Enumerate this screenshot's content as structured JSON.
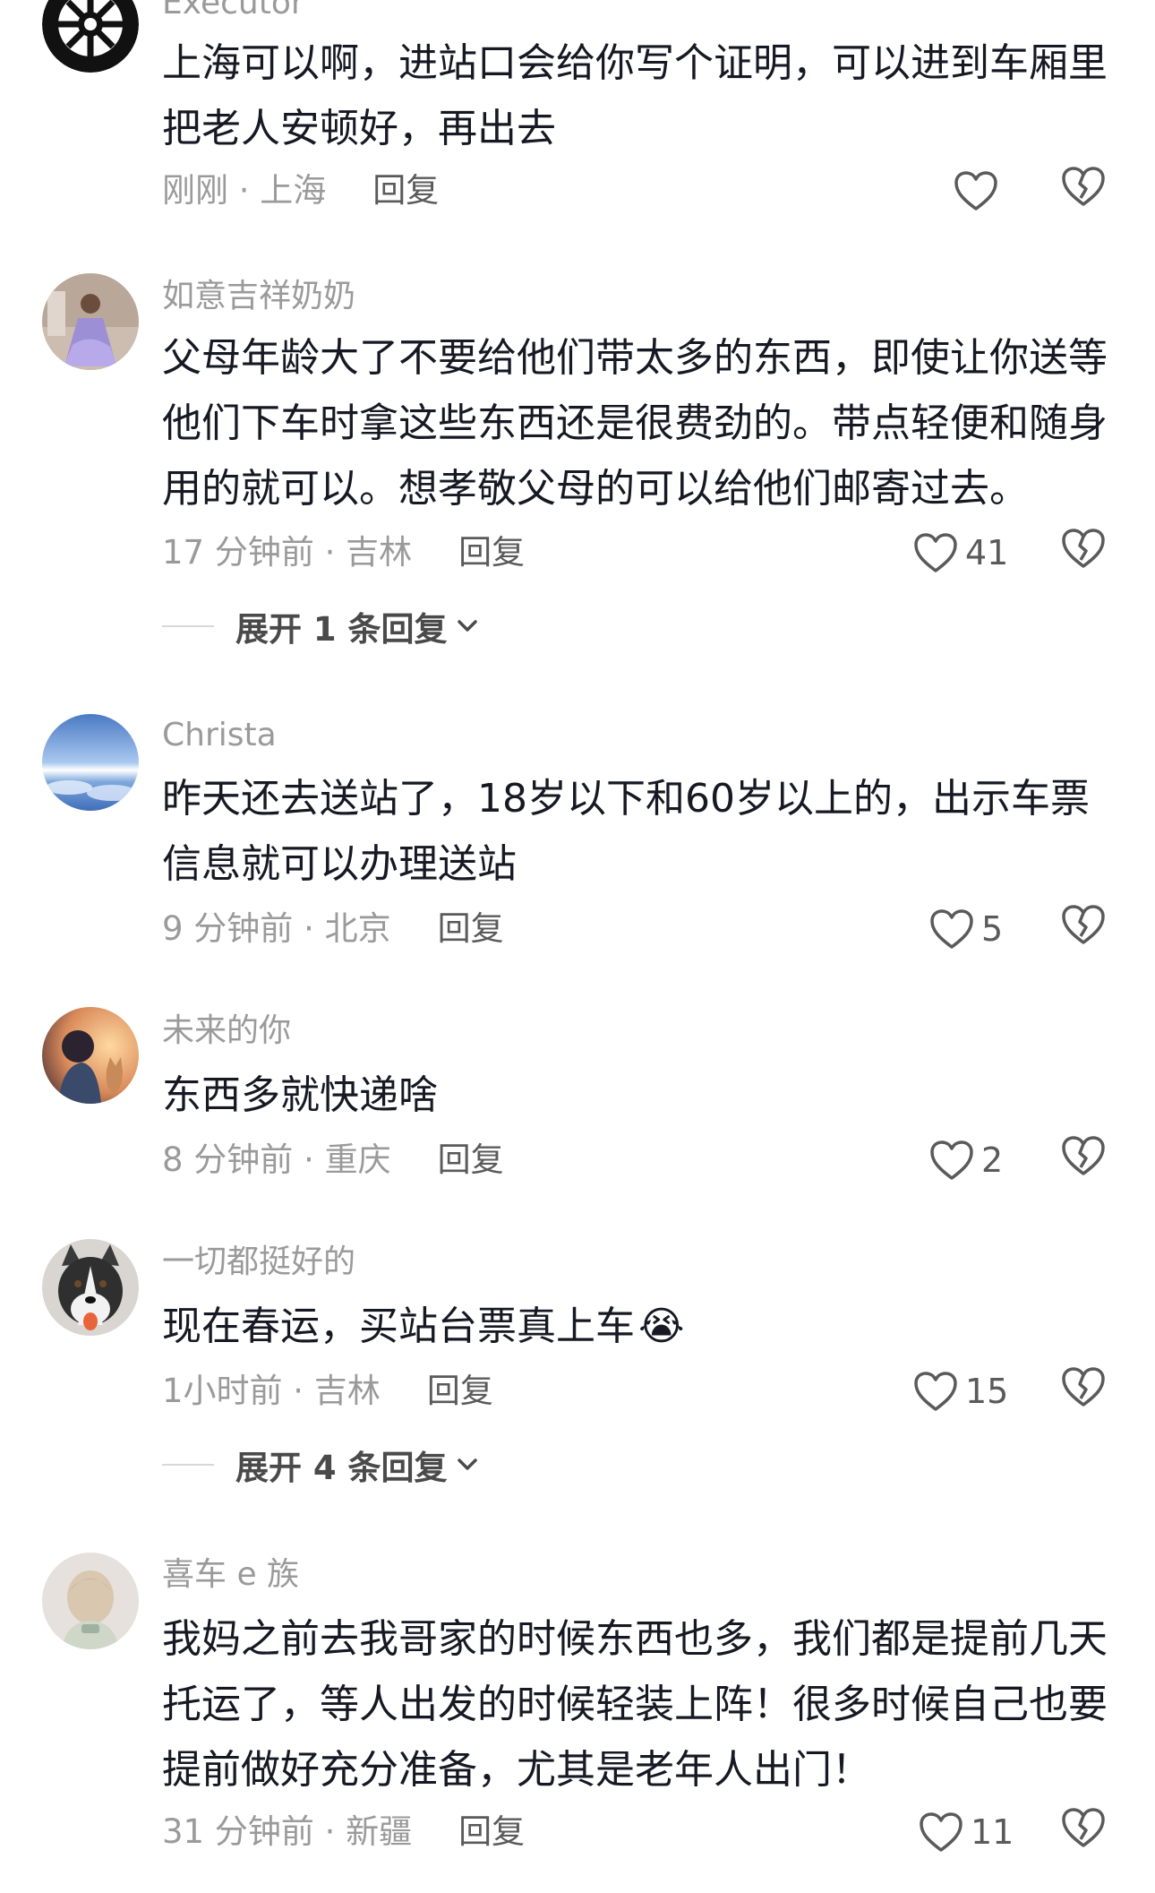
{
  "comments": [
    {
      "username": "Executor",
      "text": "上海可以啊，进站口会给你写个证明，可以进到车厢里把老人安顿好，再出去",
      "meta": "刚刚 · 上海",
      "reply_label": "回复",
      "like_count": "",
      "avatar": "empire-emblem-icon"
    },
    {
      "username": "如意吉祥奶奶",
      "text": "父母年龄大了不要给他们带太多的东西，即使让你送等他们下车时拿这些东西还是很费劲的。带点轻便和随身用的就可以。想孝敬父母的可以给他们邮寄过去。",
      "meta": "17 分钟前 · 吉林",
      "reply_label": "回复",
      "like_count": "41",
      "expand_label": "展开 1 条回复",
      "avatar": "girl-in-dress-photo"
    },
    {
      "username": "Christa",
      "text": "昨天还去送站了，18岁以下和60岁以上的，出示车票信息就可以办理送站",
      "meta": "9 分钟前 · 北京",
      "reply_label": "回复",
      "like_count": "5",
      "avatar": "ocean-sky-photo"
    },
    {
      "username": "未来的你",
      "text": "东西多就快递啥",
      "meta": "8 分钟前 · 重庆",
      "reply_label": "回复",
      "like_count": "2",
      "avatar": "anime-boy-cat-photo"
    },
    {
      "username": "一切都挺好的",
      "text": "现在春运，买站台票真上车",
      "emoji": "😭",
      "meta": "1小时前 · 吉林",
      "reply_label": "回复",
      "like_count": "15",
      "expand_label": "展开 4 条回复",
      "avatar": "husky-dog-photo"
    },
    {
      "username": "喜车 e 族",
      "text": "我妈之前去我哥家的时候东西也多，我们都是提前几天托运了，等人出发的时候轻装上阵！很多时候自己也要提前做好充分准备，尤其是老年人出门！",
      "meta": "31 分钟前 · 新疆",
      "reply_label": "回复",
      "like_count": "11",
      "avatar": "cartoon-figure-photo"
    }
  ],
  "colors": {
    "text_primary": "#161823",
    "text_secondary": "#9a9a9a",
    "icon": "#5a5a5a"
  }
}
